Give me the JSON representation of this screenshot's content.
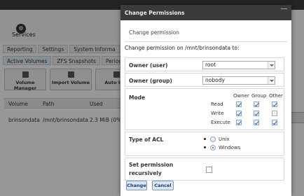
{
  "background": {
    "services_label": "Services",
    "tabs_top": [
      "Reporting",
      "Settings",
      "System Informa"
    ],
    "tabs_storage": [
      "Active Volumes",
      "ZFS Snapshots",
      "Periodic Snap"
    ],
    "toolbar": [
      "Volume Manager",
      "Import Volume",
      "Auto Imp"
    ],
    "table": {
      "columns": [
        "Volume",
        "Path",
        "Used"
      ],
      "rows": [
        [
          "brinsondata",
          "/mnt/brinsondata",
          "2.3 MiB (0%"
        ]
      ]
    }
  },
  "dialog": {
    "title": "Change Permissions",
    "subtitle": "Change permission",
    "intro": "Change permission on /mnt/brinsondata to:",
    "owner_user": {
      "label": "Owner (user)",
      "value": "root"
    },
    "owner_group": {
      "label": "Owner (group)",
      "value": "nobody"
    },
    "mode": {
      "label": "Mode",
      "headers": [
        "Owner",
        "Group",
        "Other"
      ],
      "rows": [
        {
          "label": "Read",
          "values": [
            true,
            true,
            true
          ]
        },
        {
          "label": "Write",
          "values": [
            true,
            true,
            false
          ]
        },
        {
          "label": "Execute",
          "values": [
            true,
            true,
            true
          ]
        }
      ]
    },
    "acl": {
      "label": "Type of ACL",
      "options": [
        "Unix",
        "Windows"
      ],
      "selected": "Windows"
    },
    "recursive": {
      "label_line1": "Set permission",
      "label_line2": "recursively",
      "checked": false
    },
    "buttons": {
      "change": "Change",
      "cancel": "Cancel"
    }
  }
}
